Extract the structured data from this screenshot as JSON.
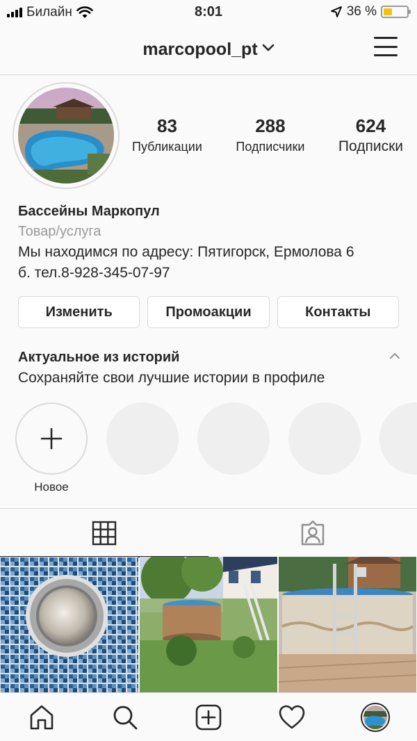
{
  "status_bar": {
    "carrier": "Билайн",
    "time": "8:01",
    "battery_percent": "36 %",
    "battery_level": 0.36,
    "battery_color": "#f3c114"
  },
  "header": {
    "username": "marcopool_pt",
    "dropdown_icon": "chevron-down-icon",
    "menu_icon": "hamburger-menu-icon"
  },
  "profile": {
    "stats": [
      {
        "value": "83",
        "label": "Публикации"
      },
      {
        "value": "288",
        "label": "Подписчики"
      },
      {
        "value": "624",
        "label": "Подписки"
      }
    ],
    "name": "Бассейны Маркопул",
    "category": "Товар/услуга",
    "bio_line1": "Мы находимся по адресу: Пятигорск, Ермолова 6",
    "bio_line2": "б. тел.8-928-345-07-97"
  },
  "buttons": {
    "edit": "Изменить",
    "promotions": "Промоакции",
    "contacts": "Контакты"
  },
  "highlights": {
    "title": "Актуальное из историй",
    "subtitle": "Сохраняйте свои лучшие истории в профиле",
    "new_label": "Новое"
  },
  "tabs": [
    {
      "icon": "grid-icon",
      "active": true
    },
    {
      "icon": "tagged-person-icon",
      "active": false
    }
  ],
  "bottom_nav": [
    {
      "icon": "home-icon"
    },
    {
      "icon": "search-icon"
    },
    {
      "icon": "add-post-icon"
    },
    {
      "icon": "heart-icon"
    },
    {
      "icon": "profile-avatar-icon"
    }
  ],
  "colors": {
    "background": "#fafafa",
    "border": "#dbdbdb",
    "text": "#262626",
    "muted": "#999999"
  }
}
